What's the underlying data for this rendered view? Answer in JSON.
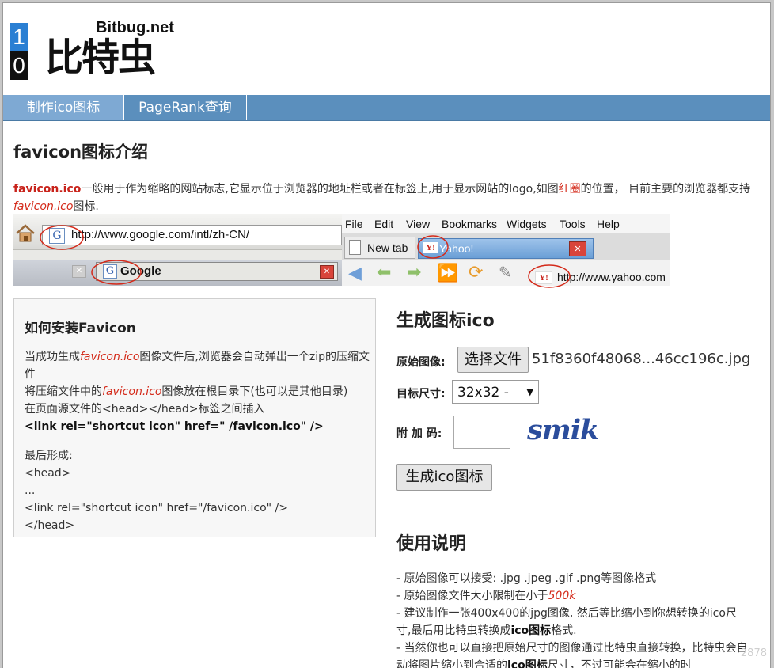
{
  "logo": {
    "digit_top": "1",
    "digit_bottom": "0",
    "brand_en": "Bitbug.net",
    "brand_cn": "比特虫"
  },
  "nav": {
    "items": [
      {
        "label": "制作ico图标"
      },
      {
        "label": "PageRank查询"
      }
    ]
  },
  "intro": {
    "title": "favicon图标介绍",
    "term": "favicon.ico",
    "text1": "一般用于作为缩略的网站标志,它显示位于浏览器的地址栏或者在标签上,用于显示网站的logo,如图",
    "highlight": "红圈",
    "text2": "的位置， 目前主要的浏览器都支持",
    "term_italic": "favicon.ico",
    "text3": "图标."
  },
  "demo": {
    "left_url": "http://www.google.com/intl/zh-CN/",
    "left_tab": "Google",
    "menu": [
      "File",
      "Edit",
      "View",
      "Bookmarks",
      "Widgets",
      "Tools",
      "Help"
    ],
    "tab_new": "New tab",
    "tab_yahoo": "Yahoo!",
    "right_url": "http://www.yahoo.com"
  },
  "howto": {
    "title": "如何安装Favicon",
    "l1a": "当成功生成",
    "l1b": "favicon.ico",
    "l1c": "图像文件后,浏览器会自动弹出一个zip的压缩文件",
    "l2a": "将压缩文件中的",
    "l2b": "favicon.ico",
    "l2c": "图像放在根目录下(也可以是其他目录)",
    "l3": "在页面源文件的<head></head>标签之间插入",
    "l4": "<link rel=\"shortcut icon\" href=\" /favicon.ico\" />",
    "l5": "最后形成:",
    "l6": "<head>",
    "l7": "...",
    "l8": "<link rel=\"shortcut icon\" href=\"/favicon.ico\" />",
    "l9": "</head>"
  },
  "generator": {
    "title": "生成图标ico",
    "source_label": "原始图像:",
    "choose_button": "选择文件",
    "filename": "51f8360f48068...46cc196c.jpg",
    "size_label": "目标尺寸:",
    "size_value": "32x32 -",
    "captcha_label": "附 加 码:",
    "captcha_text": "smik",
    "submit_button": "生成ico图标"
  },
  "usage": {
    "title": "使用说明",
    "u1": "- 原始图像可以接受: .jpg .jpeg .gif .png等图像格式",
    "u2a": "- 原始图像文件大小限制在小于",
    "u2b": "500k",
    "u3a": "- 建议制作一张400x400的jpg图像, 然后等比缩小到你想转换的ico尺寸,最后用比特虫转换成",
    "u3b": "ico图标",
    "u3c": "格式.",
    "u4a": "- 当然你也可以直接把原始尺寸的图像通过比特虫直接转换，比特虫会自动将图片缩小到合适的",
    "u4b": "ico图标",
    "u4c": "尺寸，不过可能会在缩小的时"
  },
  "watermark": "2878",
  "colors": {
    "nav_bg": "#5b8fbd",
    "nav_active": "#7ea9d3",
    "red": "#d42a1a",
    "captcha": "#2b4d9c"
  }
}
